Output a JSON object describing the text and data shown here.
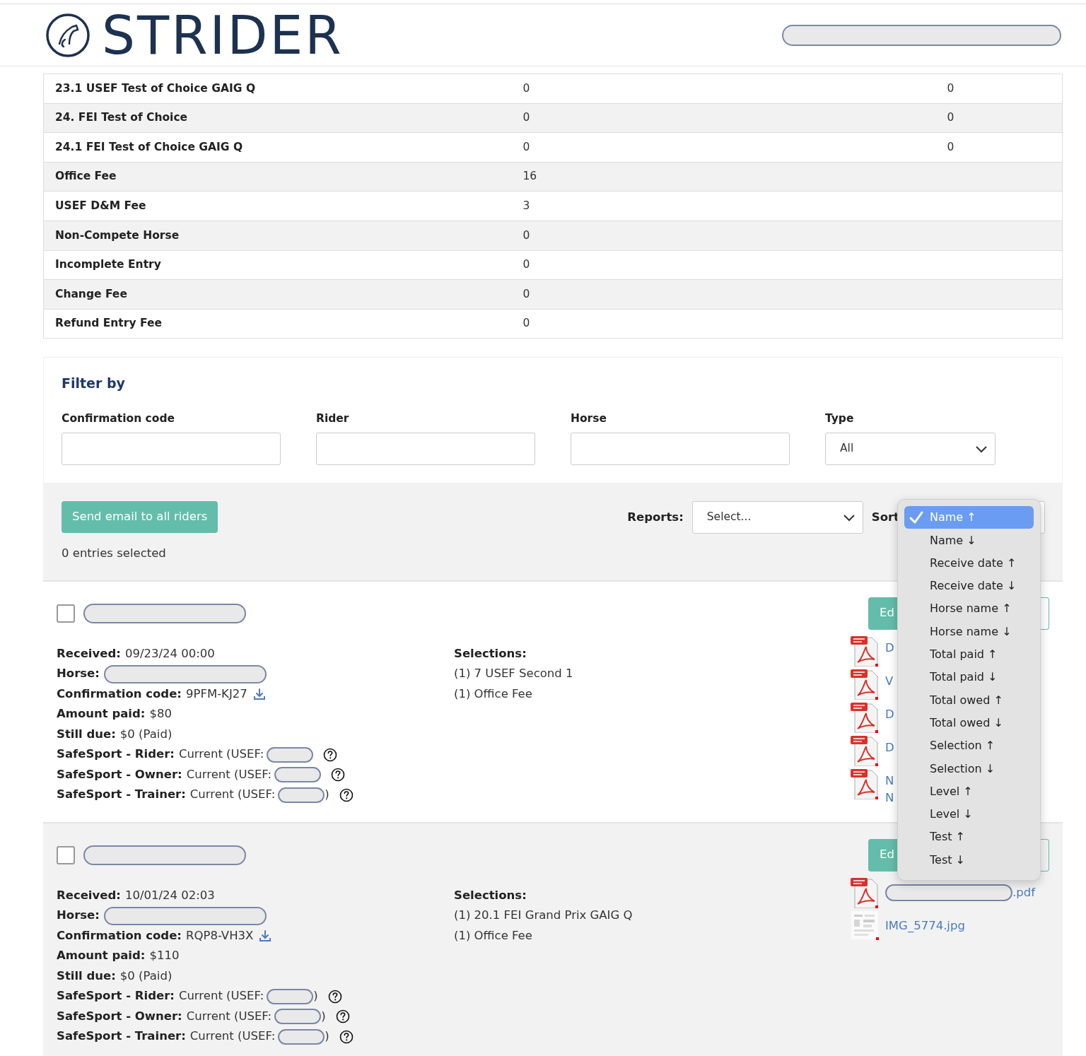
{
  "header": {
    "logo_text": "STRIDER"
  },
  "fee_table": {
    "rows": [
      {
        "label": "23.1 USEF Test of Choice GAIG Q",
        "column_2": "0",
        "column_3": "0"
      },
      {
        "label": "24. FEI Test of Choice",
        "column_2": "0",
        "column_3": "0"
      },
      {
        "label": "24.1 FEI Test of Choice GAIG Q",
        "column_2": "0",
        "column_3": "0"
      },
      {
        "label": "Office Fee",
        "column_2": "16"
      },
      {
        "label": "USEF D&M Fee",
        "column_2": "3"
      },
      {
        "label": "Non-Compete Horse",
        "column_2": "0"
      },
      {
        "label": "Incomplete Entry",
        "column_2": "0"
      },
      {
        "label": "Change Fee",
        "column_2": "0"
      },
      {
        "label": "Refund Entry Fee",
        "column_2": "0"
      }
    ]
  },
  "filter": {
    "title": "Filter by",
    "fields": [
      {
        "label": "Confirmation code",
        "kind": "text"
      },
      {
        "label": "Rider",
        "kind": "text"
      },
      {
        "label": "Horse",
        "kind": "text"
      },
      {
        "label": "Type",
        "kind": "select",
        "value": "All"
      }
    ]
  },
  "toolbar": {
    "send_button": "Send email to all riders",
    "selected_count": "0 entries selected",
    "reports_label": "Reports:",
    "reports_value": "Select...",
    "sort_label": "Sort"
  },
  "sort_menu": [
    {
      "label": "Name ↑",
      "selected": true
    },
    {
      "label": "Name ↓",
      "selected": false
    },
    {
      "label": "Receive date ↑",
      "selected": false
    },
    {
      "label": "Receive date ↓",
      "selected": false
    },
    {
      "label": "Horse name ↑",
      "selected": false
    },
    {
      "label": "Horse name ↓",
      "selected": false
    },
    {
      "label": "Total paid ↑",
      "selected": false
    },
    {
      "label": "Total paid ↓",
      "selected": false
    },
    {
      "label": "Total owed ↑",
      "selected": false
    },
    {
      "label": "Total owed ↓",
      "selected": false
    },
    {
      "label": "Selection ↑",
      "selected": false
    },
    {
      "label": "Selection ↓",
      "selected": false
    },
    {
      "label": "Level ↑",
      "selected": false
    },
    {
      "label": "Level ↓",
      "selected": false
    },
    {
      "label": "Test ↑",
      "selected": false
    },
    {
      "label": "Test ↓",
      "selected": false
    }
  ],
  "entries": [
    {
      "checked": false,
      "edit_button": "Ed",
      "details": [
        {
          "kind": "text",
          "label": "Received:",
          "value": "09/23/24 00:00"
        },
        {
          "kind": "redacted",
          "label": "Horse:"
        },
        {
          "kind": "download",
          "label": "Confirmation code:",
          "value": "9PFM-KJ27"
        },
        {
          "kind": "text",
          "label": "Amount paid:",
          "value": "$80"
        },
        {
          "kind": "text",
          "label": "Still due:",
          "value": "$0 (Paid)"
        },
        {
          "kind": "safesport",
          "label": "SafeSport - Rider:",
          "value": "Current (USEF:"
        },
        {
          "kind": "safesport",
          "label": "SafeSport - Owner:",
          "value": "Current (USEF:"
        },
        {
          "kind": "safesport",
          "label": "SafeSport - Trainer:",
          "value": "Current (USEF:",
          "after": ")"
        }
      ],
      "selections_title": "Selections:",
      "selections": [
        "(1) 7 USEF Second 1",
        "(1) Office Fee"
      ],
      "files": [
        {
          "kind": "pdf",
          "lines": [
            "D"
          ]
        },
        {
          "kind": "pdf",
          "lines": [
            "V"
          ]
        },
        {
          "kind": "pdf",
          "lines": [
            "D"
          ]
        },
        {
          "kind": "pdf",
          "lines": [
            "D"
          ]
        },
        {
          "kind": "pdf",
          "lines": [
            "N",
            "N"
          ]
        }
      ]
    },
    {
      "checked": false,
      "edit_button": "Ed",
      "details": [
        {
          "kind": "text",
          "label": "Received:",
          "value": "10/01/24 02:03"
        },
        {
          "kind": "redacted",
          "label": "Horse:"
        },
        {
          "kind": "download",
          "label": "Confirmation code:",
          "value": "RQP8-VH3X"
        },
        {
          "kind": "text",
          "label": "Amount paid:",
          "value": "$110"
        },
        {
          "kind": "text",
          "label": "Still due:",
          "value": "$0 (Paid)"
        },
        {
          "kind": "safesport",
          "label": "SafeSport - Rider:",
          "value": "Current (USEF:",
          "after": ")"
        },
        {
          "kind": "safesport",
          "label": "SafeSport - Owner:",
          "value": "Current (USEF:",
          "after": ")"
        },
        {
          "kind": "safesport",
          "label": "SafeSport - Trainer:",
          "value": "Current (USEF:",
          "after": ")"
        }
      ],
      "selections_title": "Selections:",
      "selections": [
        "(1) 20.1 FEI Grand Prix GAIG Q",
        "(1) Office Fee"
      ],
      "files": [
        {
          "kind": "pdf",
          "redacted": true,
          "lines": [
            ".pdf"
          ]
        },
        {
          "lines": [
            "IMG_5774.jpg"
          ]
        }
      ]
    }
  ]
}
